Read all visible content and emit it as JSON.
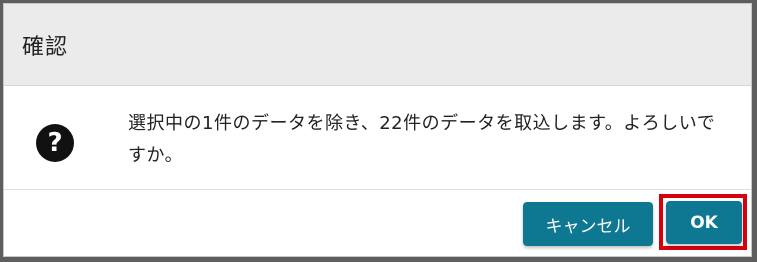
{
  "dialog": {
    "title": "確認",
    "icon": "question-circle-icon",
    "message": "選択中の1件のデータを除き、22件のデータを取込します。よろしいですか。",
    "buttons": {
      "cancel_label": "キャンセル",
      "ok_label": "OK"
    },
    "colors": {
      "button": "#0e7892",
      "highlight": "#d6000f",
      "header": "#ebebeb"
    }
  }
}
